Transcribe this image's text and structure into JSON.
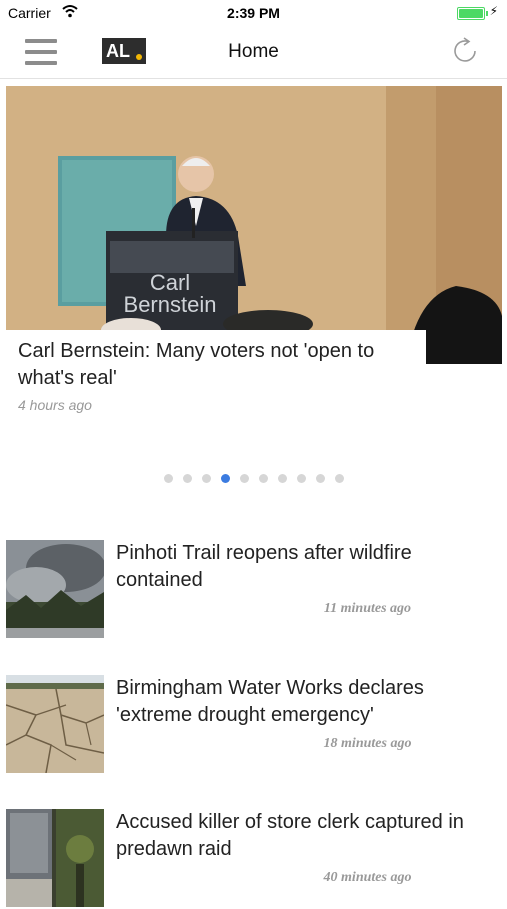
{
  "status_bar": {
    "carrier": "Carrier",
    "time": "2:39 PM"
  },
  "nav": {
    "title": "Home",
    "logo_text": "AL"
  },
  "hero": {
    "title": "Carl Bernstein: Many voters not 'open to what's real'",
    "time": "4 hours ago",
    "podium_text_1": "Carl",
    "podium_text_2": "Bernstein"
  },
  "carousel": {
    "page_count": 10,
    "active_index": 3
  },
  "stories": [
    {
      "title": "Pinhoti Trail reopens after wildfire contained",
      "time": "11 minutes ago"
    },
    {
      "title": "Birmingham Water Works declares 'extreme drought emergency'",
      "time": "18 minutes ago"
    },
    {
      "title": "Accused killer of store clerk captured in predawn raid",
      "time": "40 minutes ago"
    }
  ],
  "colors": {
    "accent": "#3b7be0",
    "battery": "#4cd964",
    "logo_dot": "#f2b705"
  }
}
